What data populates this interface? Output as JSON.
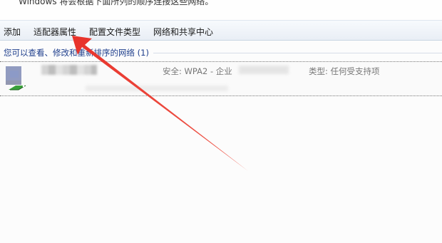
{
  "header": {
    "top_text": "Windows 将会根据下面所列的顺序连接这些网络。"
  },
  "toolbar": {
    "items": [
      {
        "label": "添加"
      },
      {
        "label": "适配器属性"
      },
      {
        "label": "配置文件类型"
      },
      {
        "label": "网络和共享中心"
      }
    ]
  },
  "group": {
    "header": "您可以查看、修改和重新排序的网络 (1)"
  },
  "network": {
    "security": "安全: WPA2 - 企业",
    "type": "类型: 任何受支持项"
  },
  "colors": {
    "annotation_arrow": "#e8322a",
    "group_text": "#1e3e8c"
  },
  "icons": [
    "wireless-network-icon",
    "annotation-arrow"
  ]
}
